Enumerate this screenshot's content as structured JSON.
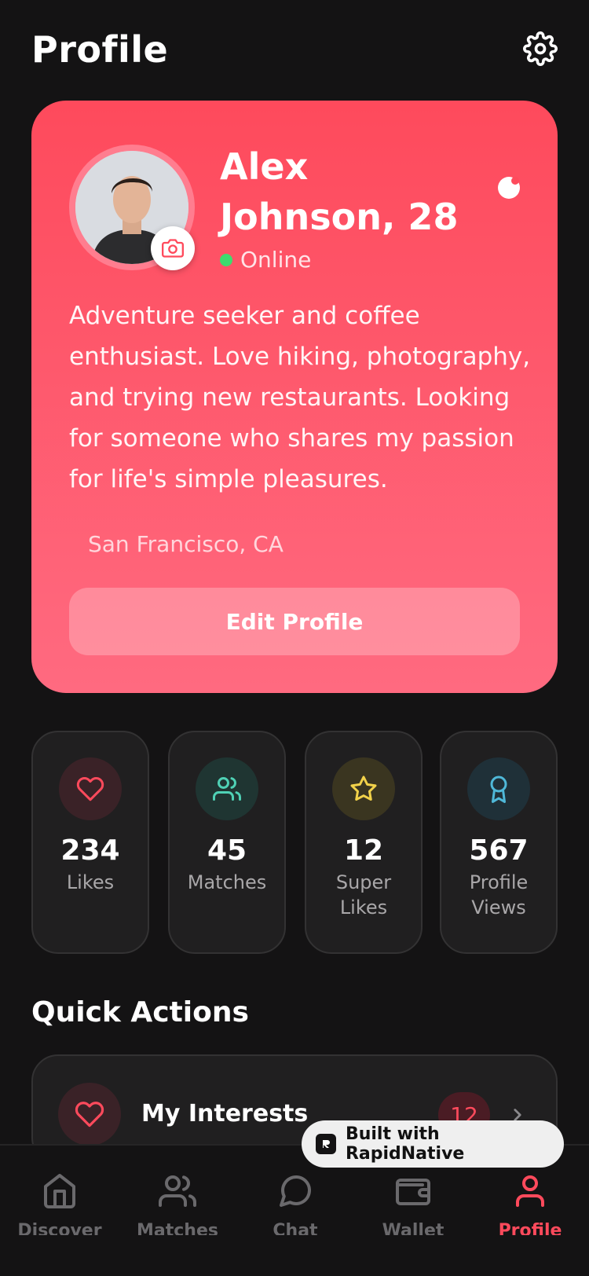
{
  "header": {
    "title": "Profile"
  },
  "profile": {
    "name": "Alex Johnson, 28",
    "status": "Online",
    "bio": "Adventure seeker and coffee enthusiast. Love hiking, photography, and trying new restaurants. Looking for someone who shares my passion for life's simple pleasures.",
    "location": "San Francisco, CA",
    "edit_label": "Edit Profile"
  },
  "stats": [
    {
      "value": "234",
      "label": "Likes",
      "icon": "heart-icon",
      "color": "#ff4a5c",
      "bg": "#3a2227"
    },
    {
      "value": "45",
      "label": "Matches",
      "icon": "users-icon",
      "color": "#4fd1b5",
      "bg": "#1f3532"
    },
    {
      "value": "12",
      "label": "Super Likes",
      "icon": "star-icon",
      "color": "#f2d24a",
      "bg": "#3a3520"
    },
    {
      "value": "567",
      "label": "Profile Views",
      "icon": "award-icon",
      "color": "#4fb8d8",
      "bg": "#1f3038"
    }
  ],
  "quick_actions": {
    "title": "Quick Actions",
    "items": [
      {
        "label": "My Interests",
        "badge": "12"
      }
    ]
  },
  "built_with": "Built with RapidNative",
  "tabs": [
    {
      "label": "Discover"
    },
    {
      "label": "Matches"
    },
    {
      "label": "Chat"
    },
    {
      "label": "Wallet"
    },
    {
      "label": "Profile",
      "active": true
    }
  ],
  "colors": {
    "accent": "#ff4a5c",
    "background": "#141314",
    "card": "#201f20",
    "online": "#3ddc6e"
  }
}
